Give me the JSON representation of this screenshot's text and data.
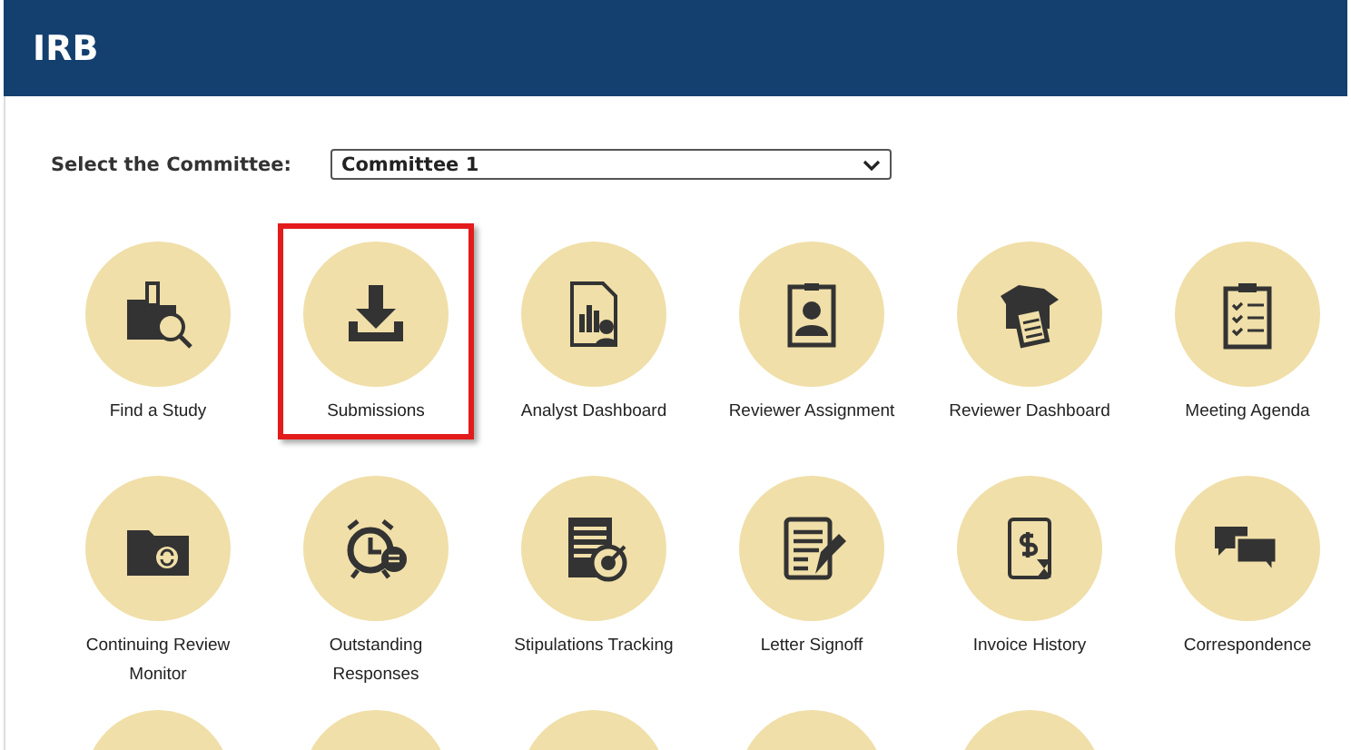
{
  "header": {
    "title": "IRB"
  },
  "committee": {
    "label": "Select the Committee:",
    "value": "Committee 1"
  },
  "tiles": [
    {
      "kind": "full",
      "label": "Find a Study",
      "selected": false
    },
    {
      "kind": "full",
      "label": "Submissions",
      "selected": true
    },
    {
      "kind": "full",
      "label": "Analyst Dashboard",
      "selected": false
    },
    {
      "kind": "full",
      "label": "Reviewer Assignment",
      "selected": false
    },
    {
      "kind": "full",
      "label": "Reviewer Dashboard",
      "selected": false
    },
    {
      "kind": "full",
      "label": "Meeting Agenda",
      "selected": false
    },
    {
      "kind": "full",
      "label": "Continuing Review Monitor",
      "selected": false
    },
    {
      "kind": "full",
      "label": "Outstanding Responses",
      "selected": false
    },
    {
      "kind": "full",
      "label": "Stipulations Tracking",
      "selected": false
    },
    {
      "kind": "full",
      "label": "Letter Signoff",
      "selected": false
    },
    {
      "kind": "full",
      "label": "Invoice History",
      "selected": false
    },
    {
      "kind": "full",
      "label": "Correspondence",
      "selected": false
    },
    {
      "kind": "cut",
      "selected": false
    },
    {
      "kind": "cut",
      "selected": false
    },
    {
      "kind": "cut",
      "selected": false
    },
    {
      "kind": "cut",
      "selected": false
    },
    {
      "kind": "cut",
      "selected": false
    }
  ]
}
